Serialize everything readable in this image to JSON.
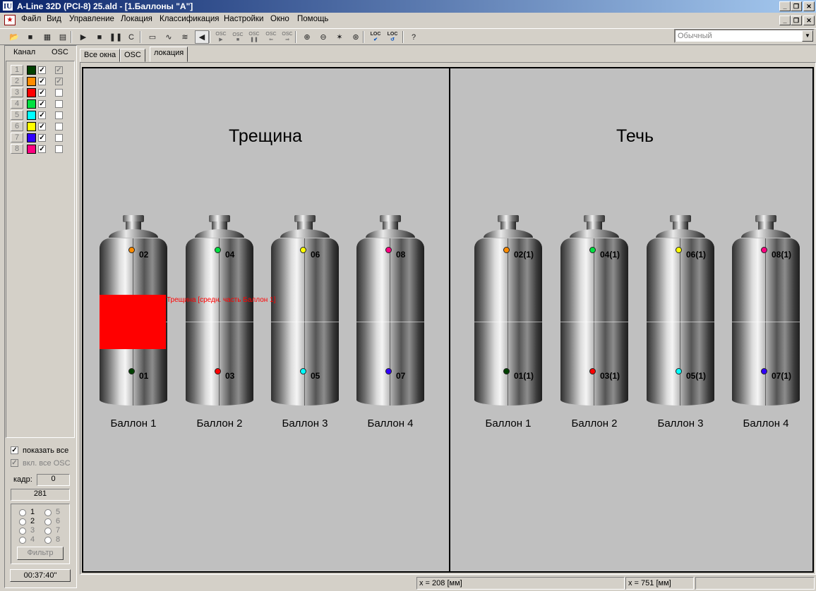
{
  "window": {
    "title": "A-Line 32D (PCI-8) 25.ald - [1.Баллоны \"A\"]",
    "app_icon": "IU"
  },
  "menu": [
    "Файл",
    "Вид",
    "Управление",
    "Локация",
    "Классификация",
    "Настройки",
    "Окно",
    "Помощь"
  ],
  "toolbar": {
    "mode_value": "Обычный",
    "icons": [
      "open-folder-icon",
      "stop-square-icon",
      "table-icon",
      "document-icon",
      "play-icon",
      "stop-icon",
      "pause-icon",
      "c-icon",
      "probe-icon",
      "waveform-icon",
      "waveform-grid-icon",
      "speaker-icon",
      "osc-play-icon",
      "osc-stop-icon",
      "osc-pause-icon",
      "osc-back-icon",
      "osc-forward-icon",
      "zoom-in-icon",
      "zoom-out-icon",
      "star-icon",
      "target-icon",
      "loc-check-icon",
      "loc-undo-icon",
      "help-icon"
    ],
    "osc_label": "OSC",
    "loc_label": "LOC"
  },
  "left_panel": {
    "col_channel": "Канал",
    "col_osc": "OSC",
    "channels": [
      {
        "num": "1",
        "color": "#004000",
        "checked": true,
        "osc": true
      },
      {
        "num": "2",
        "color": "#ff8c00",
        "checked": true,
        "osc": true
      },
      {
        "num": "3",
        "color": "#ff0000",
        "checked": true,
        "osc": false
      },
      {
        "num": "4",
        "color": "#00e040",
        "checked": true,
        "osc": false
      },
      {
        "num": "5",
        "color": "#00ffff",
        "checked": true,
        "osc": false
      },
      {
        "num": "6",
        "color": "#ffff00",
        "checked": true,
        "osc": false
      },
      {
        "num": "7",
        "color": "#3000ff",
        "checked": true,
        "osc": false
      },
      {
        "num": "8",
        "color": "#ff0080",
        "checked": true,
        "osc": false
      }
    ],
    "show_all": "показать все",
    "enable_all_osc": "вкл. все OSC",
    "frame_label": "кадр:",
    "frame_value": "0",
    "count_value": "281",
    "radios": [
      "1",
      "2",
      "3",
      "4",
      "5",
      "6",
      "7",
      "8"
    ],
    "filter_button": "Фильтр",
    "time_value": "00:37:40\""
  },
  "tabs": [
    "Все окна",
    "OSC",
    "локация"
  ],
  "panels": [
    {
      "title": "Трещина",
      "cylinders": [
        {
          "label": "Баллон 1",
          "top_sensor": "02",
          "top_color": "#ff8c00",
          "bottom_sensor": "01",
          "bottom_color": "#004000"
        },
        {
          "label": "Баллон 2",
          "top_sensor": "04",
          "top_color": "#00e040",
          "bottom_sensor": "03",
          "bottom_color": "#ff0000"
        },
        {
          "label": "Баллон 3",
          "top_sensor": "06",
          "top_color": "#ffff00",
          "bottom_sensor": "05",
          "bottom_color": "#00ffff"
        },
        {
          "label": "Баллон 4",
          "top_sensor": "08",
          "top_color": "#ff0080",
          "bottom_sensor": "07",
          "bottom_color": "#3000ff"
        }
      ]
    },
    {
      "title": "Течь",
      "cylinders": [
        {
          "label": "Баллон 1",
          "top_sensor": "02(1)",
          "top_color": "#ff8c00",
          "bottom_sensor": "01(1)",
          "bottom_color": "#004000"
        },
        {
          "label": "Баллон 2",
          "top_sensor": "04(1)",
          "top_color": "#00e040",
          "bottom_sensor": "03(1)",
          "bottom_color": "#ff0000"
        },
        {
          "label": "Баллон 3",
          "top_sensor": "06(1)",
          "top_color": "#ffff00",
          "bottom_sensor": "05(1)",
          "bottom_color": "#00ffff"
        },
        {
          "label": "Баллон 4",
          "top_sensor": "08(1)",
          "top_color": "#ff0080",
          "bottom_sensor": "07(1)",
          "bottom_color": "#3000ff"
        }
      ]
    }
  ],
  "crack_event": {
    "label": "Трещина [средн. часть Баллон 1]",
    "color": "#ff0000"
  },
  "status": {
    "x1": "x = 208 [мм]",
    "x2": "x = 751 [мм]"
  }
}
